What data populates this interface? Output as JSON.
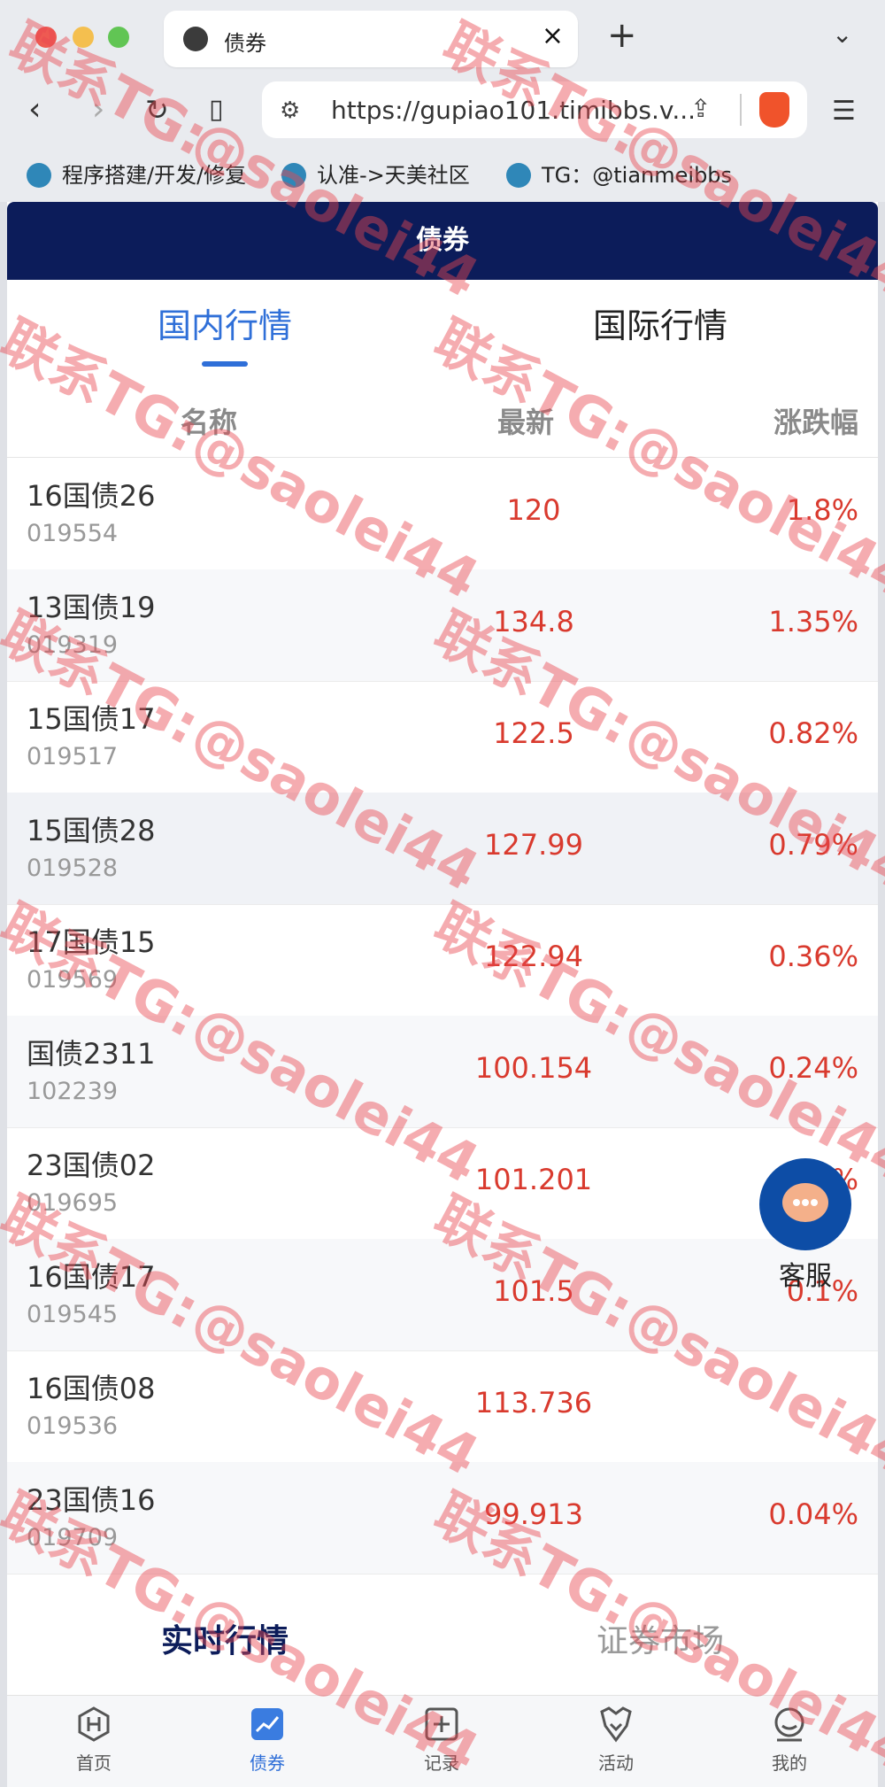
{
  "browser": {
    "tab_title": "债券",
    "url": "https://gupiao101.timibbs.v...",
    "bookmarks": [
      "程序搭建/开发/修复",
      "认准->天美社区",
      "TG：@tianmeibbs"
    ],
    "traffic_colors": [
      "#ee5a52",
      "#f4bf4f",
      "#61c554"
    ]
  },
  "header": {
    "title": "债券"
  },
  "tabs": {
    "domestic": "国内行情",
    "international": "国际行情"
  },
  "columns": {
    "name": "名称",
    "latest": "最新",
    "change": "涨跌幅"
  },
  "rows": [
    {
      "name": "16国债26",
      "code": "019554",
      "price": "120",
      "change": "1.8%"
    },
    {
      "name": "13国债19",
      "code": "019319",
      "price": "134.8",
      "change": "1.35%"
    },
    {
      "name": "15国债17",
      "code": "019517",
      "price": "122.5",
      "change": "0.82%"
    },
    {
      "name": "15国债28",
      "code": "019528",
      "price": "127.99",
      "change": "0.79%"
    },
    {
      "name": "17国债15",
      "code": "019569",
      "price": "122.94",
      "change": "0.36%"
    },
    {
      "name": "国债2311",
      "code": "102239",
      "price": "100.154",
      "change": "0.24%"
    },
    {
      "name": "23国债02",
      "code": "019695",
      "price": "101.201",
      "change": "0.1%"
    },
    {
      "name": "16国债17",
      "code": "019545",
      "price": "101.5",
      "change": "0.1%"
    },
    {
      "name": "16国债08",
      "code": "019536",
      "price": "113.736",
      "change": ""
    },
    {
      "name": "23国债16",
      "code": "019709",
      "price": "99.913",
      "change": "0.04%"
    }
  ],
  "subtabs": {
    "realtime": "实时行情",
    "market": "证券市场"
  },
  "service": {
    "label": "客服"
  },
  "bottom_nav": [
    "首页",
    "债券",
    "记录",
    "活动",
    "我的"
  ],
  "watermark": {
    "line1": "联系TG:",
    "line2": "@saolei44"
  },
  "colors": {
    "header": "#0c1c5a",
    "accent": "#2f6fd8",
    "up": "#d93a2e"
  }
}
